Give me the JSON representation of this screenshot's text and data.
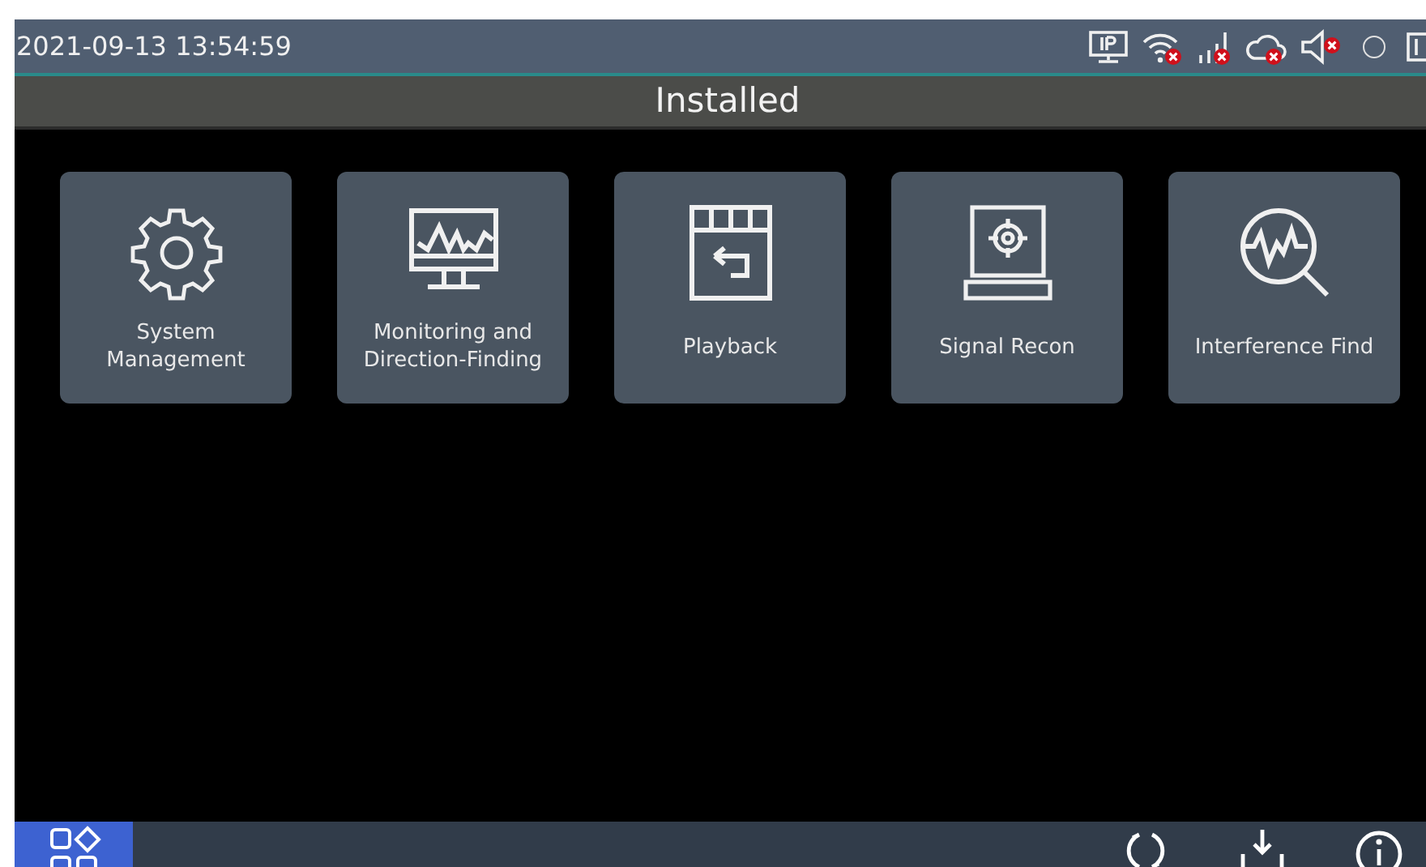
{
  "status_bar": {
    "time": "2021-09-13 13:54:59",
    "ip_connected": true,
    "wifi_connected": false,
    "cellular_connected": false,
    "cloud_connected": false,
    "sound_on": false
  },
  "title": "Installed",
  "apps": [
    {
      "label": "System\nManagement"
    },
    {
      "label": "Monitoring and\nDirection-Finding"
    },
    {
      "label": "Playback"
    },
    {
      "label": "Signal Recon"
    },
    {
      "label": "Interference Find"
    }
  ],
  "bottom_bar": {
    "apps_button": {
      "selected": true
    }
  }
}
